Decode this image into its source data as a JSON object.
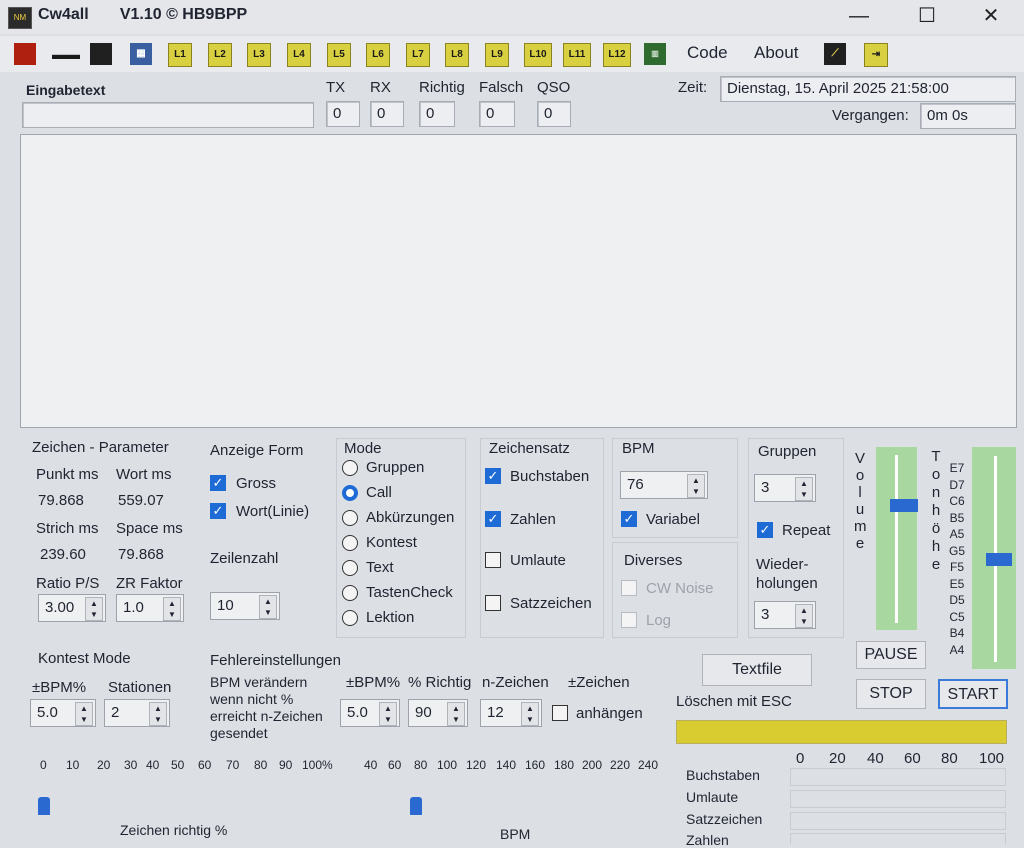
{
  "title": {
    "app": "Cw4all",
    "version": "V1.10 © HB9BPP"
  },
  "window": {
    "minimize": "—",
    "maximize": "☐",
    "close": "✕"
  },
  "toolbar": {
    "buttons": [
      "L1",
      "L2",
      "L3",
      "L4",
      "L5",
      "L6",
      "L7",
      "L8",
      "L9",
      "L10",
      "L11",
      "L12"
    ],
    "code": "Code",
    "about": "About"
  },
  "header": {
    "eingabetext": "Eingabetext",
    "tx": "TX",
    "rx": "RX",
    "richtig": "Richtig",
    "falsch": "Falsch",
    "qso": "QSO",
    "tx_val": "0",
    "rx_val": "0",
    "richtig_val": "0",
    "falsch_val": "0",
    "qso_val": "0",
    "zeit_label": "Zeit:",
    "zeit_val": "Dienstag, 15. April 2025 21:58:00",
    "vergangen_label": "Vergangen:",
    "vergangen_val": "0m 0s"
  },
  "zeichen": {
    "title": "Zeichen - Parameter",
    "punkt": "Punkt ms",
    "punkt_val": "79.868",
    "wort": "Wort ms",
    "wort_val": "559.07",
    "strich": "Strich ms",
    "strich_val": "239.60",
    "space": "Space ms",
    "space_val": "79.868",
    "ratio": "Ratio P/S",
    "ratio_val": "3.00",
    "zr": "ZR Faktor",
    "zr_val": "1.0"
  },
  "anzeige": {
    "title": "Anzeige Form",
    "gross": "Gross",
    "wort": "Wort(Linie)",
    "zeilenzahl": "Zeilenzahl",
    "zeilen_val": "10"
  },
  "mode": {
    "title": "Mode",
    "items": [
      "Gruppen",
      "Call",
      "Abkürzungen",
      "Kontest",
      "Text",
      "TastenCheck",
      "Lektion"
    ]
  },
  "zeichensatz": {
    "title": "Zeichensatz",
    "buchstaben": "Buchstaben",
    "zahlen": "Zahlen",
    "umlaute": "Umlaute",
    "satzzeichen": "Satzzeichen"
  },
  "bpm": {
    "title": "BPM",
    "value": "76",
    "variabel": "Variabel",
    "diverses": "Diverses",
    "cwnoise": "CW Noise",
    "log": "Log"
  },
  "gruppen": {
    "title": "Gruppen",
    "value": "3",
    "repeat": "Repeat",
    "wieder1": "Wieder-",
    "wieder2": "holungen",
    "wieder_val": "3"
  },
  "volume": {
    "label": "Volume",
    "level": 0.7
  },
  "tonhoehe": {
    "label": "Tonhöhe",
    "notes": [
      "E7",
      "D7",
      "C6",
      "B5",
      "A5",
      "G5",
      "F5",
      "E5",
      "D5",
      "C5",
      "B4",
      "A4"
    ],
    "level": 0.5
  },
  "buttons": {
    "pause": "PAUSE",
    "stop": "STOP",
    "start": "START",
    "textfile": "Textfile",
    "loeschen": "Löschen mit ESC"
  },
  "kontest": {
    "title": "Kontest Mode",
    "bpm": "±BPM%",
    "bpm_val": "5.0",
    "stationen": "Stationen",
    "stationen_val": "2"
  },
  "fehler": {
    "title": "Fehlereinstellungen",
    "desc1": "BPM verändern",
    "desc2": "wenn nicht %",
    "desc3": "erreicht n-Zeichen",
    "desc4": "gesendet",
    "bpm": "±BPM%",
    "bpm_val": "5.0",
    "richtig": "% Richtig",
    "richtig_val": "90",
    "nz": "n-Zeichen",
    "nz_val": "12",
    "pz": "±Zeichen",
    "anhaengen": "anhängen"
  },
  "scale_pct": {
    "ticks": [
      "0",
      "10",
      "20",
      "30",
      "40",
      "50",
      "60",
      "70",
      "80",
      "90",
      "100%"
    ],
    "label": "Zeichen richtig %"
  },
  "scale_bpm": {
    "ticks": [
      "40",
      "60",
      "80",
      "100",
      "120",
      "140",
      "160",
      "180",
      "200",
      "220",
      "240"
    ],
    "label": "BPM"
  },
  "stats": {
    "ticks": [
      "0",
      "20",
      "40",
      "60",
      "80",
      "100"
    ],
    "rows": [
      "Buchstaben",
      "Umlaute",
      "Satzzeichen",
      "Zahlen"
    ]
  },
  "colors": {
    "accent": "#1e6bd6",
    "progress": "#d8cc30",
    "slider": "#a8d8a0"
  }
}
